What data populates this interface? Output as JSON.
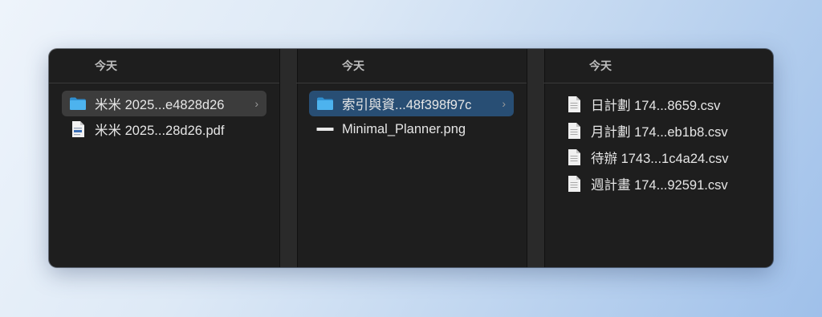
{
  "columns": [
    {
      "header": "今天",
      "items": [
        {
          "label": "米米 2025...e4828d26",
          "icon": "folder-icon",
          "selected": "grey",
          "has_children": true
        },
        {
          "label": "米米 2025...28d26.pdf",
          "icon": "pdf-file-icon",
          "selected": "",
          "has_children": false
        }
      ]
    },
    {
      "header": "今天",
      "items": [
        {
          "label": "索引與資...48f398f97c",
          "icon": "folder-icon",
          "selected": "blue",
          "has_children": true
        },
        {
          "label": "Minimal_Planner.png",
          "icon": "image-file-icon",
          "selected": "",
          "has_children": false
        }
      ]
    },
    {
      "header": "今天",
      "items": [
        {
          "label": "日計劃 174...8659.csv",
          "icon": "document-icon"
        },
        {
          "label": "月計劃 174...eb1b8.csv",
          "icon": "document-icon"
        },
        {
          "label": "待辦 1743...1c4a24.csv",
          "icon": "document-icon"
        },
        {
          "label": "週計畫 174...92591.csv",
          "icon": "document-icon"
        }
      ]
    }
  ],
  "chevron": "›",
  "colors": {
    "window_bg": "#1e1e1e",
    "selected_grey": "#3c3c3c",
    "selected_blue": "#284e74",
    "folder_blue": "#3aa3e3"
  }
}
